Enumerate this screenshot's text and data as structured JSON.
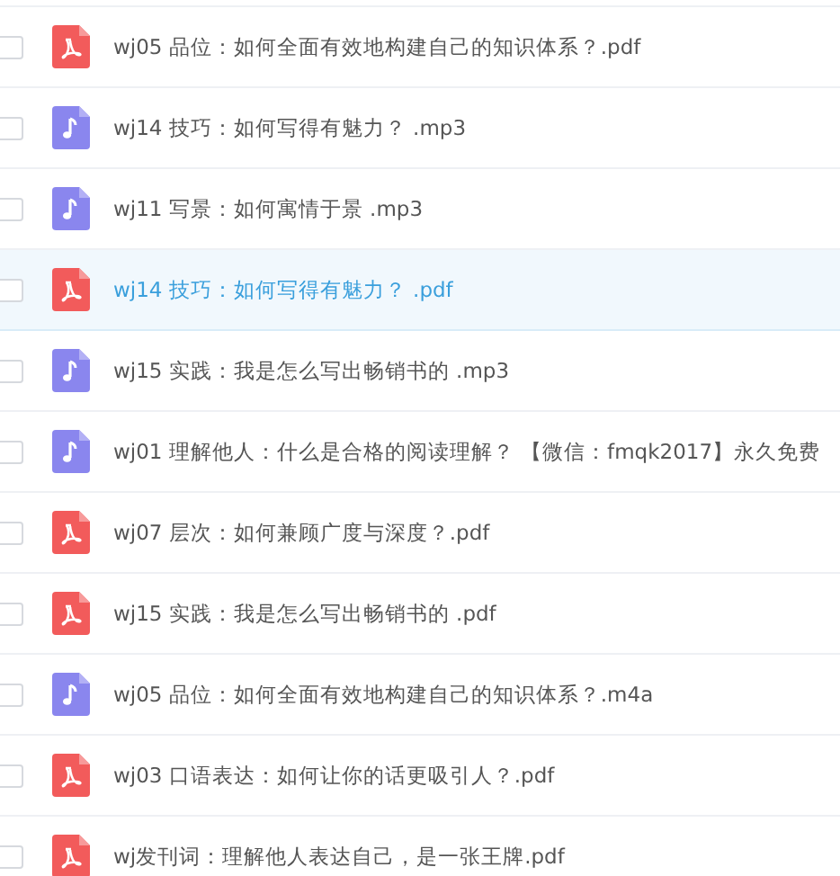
{
  "files": [
    {
      "name": "wj05 品位：如何全面有效地构建自己的知识体系？.pdf",
      "kind": "pdf",
      "selected": false,
      "checked": false
    },
    {
      "name": "wj14 技巧：如何写得有魅力？ .mp3",
      "kind": "audio",
      "selected": false,
      "checked": false
    },
    {
      "name": "wj11 写景：如何寓情于景 .mp3",
      "kind": "audio",
      "selected": false,
      "checked": false
    },
    {
      "name": "wj14 技巧：如何写得有魅力？ .pdf",
      "kind": "pdf",
      "selected": true,
      "checked": false
    },
    {
      "name": "wj15 实践：我是怎么写出畅销书的 .mp3",
      "kind": "audio",
      "selected": false,
      "checked": false
    },
    {
      "name": "wj01 理解他人：什么是合格的阅读理解？ 【微信：fmqk2017】永久免费",
      "kind": "audio",
      "selected": false,
      "checked": false
    },
    {
      "name": "wj07 层次：如何兼顾广度与深度？.pdf",
      "kind": "pdf",
      "selected": false,
      "checked": false
    },
    {
      "name": "wj15 实践：我是怎么写出畅销书的 .pdf",
      "kind": "pdf",
      "selected": false,
      "checked": false
    },
    {
      "name": "wj05 品位：如何全面有效地构建自己的知识体系？.m4a",
      "kind": "audio",
      "selected": false,
      "checked": false
    },
    {
      "name": "wj03 口语表达：如何让你的话更吸引人？.pdf",
      "kind": "pdf",
      "selected": false,
      "checked": false
    },
    {
      "name": "wj发刊词：理解他人表达自己，是一张王牌.pdf",
      "kind": "pdf",
      "selected": false,
      "checked": false
    }
  ]
}
